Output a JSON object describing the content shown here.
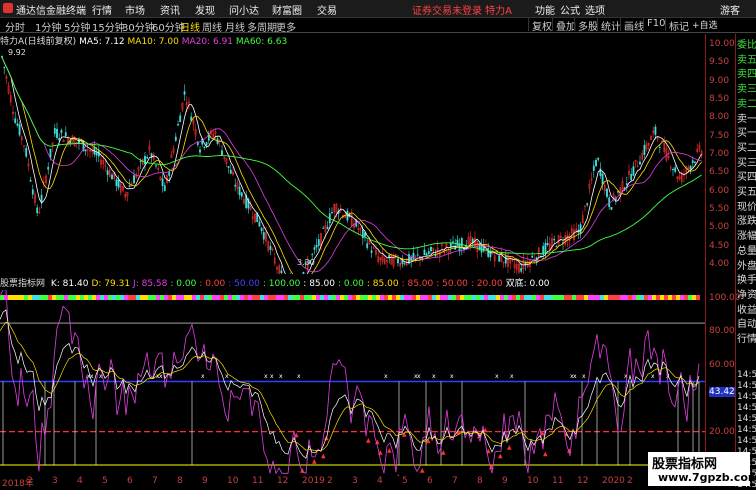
{
  "window": {
    "app_title": "通达信金融终端",
    "menus": [
      "行情",
      "市场",
      "资讯",
      "发现",
      "问小达",
      "财富圈",
      "交易"
    ],
    "warning": "证券交易未登录  特力A",
    "right_menus": [
      "功能",
      "公式",
      "选项"
    ],
    "user": "游客"
  },
  "toolbar": {
    "periods": [
      "分时",
      "1分钟",
      "5分钟",
      "15分钟",
      "30分钟",
      "60分钟",
      "日线",
      "周线",
      "月线",
      "多周期",
      "更多"
    ],
    "active_period": "日线",
    "right_items": [
      "复权",
      "叠加",
      "多股",
      "统计",
      "画线",
      "F10",
      "标记"
    ]
  },
  "main_chart": {
    "stock": "特力A(日线前复权)",
    "ma": [
      {
        "label": "MA5: 7.12",
        "color": "#ffffff"
      },
      {
        "label": "MA10: 7.00",
        "color": "#ffdf00"
      },
      {
        "label": "MA20: 6.91",
        "color": "#e040e0"
      },
      {
        "label": "MA60: 6.63",
        "color": "#40ff40"
      }
    ],
    "high_label": "9.92",
    "low_label": "3.30",
    "y_ticks": [
      "10.00",
      "9.50",
      "9.00",
      "8.50",
      "8.00",
      "7.50",
      "7.00",
      "6.50",
      "6.00",
      "5.50",
      "5.00",
      "4.50",
      "4.00"
    ]
  },
  "sub_chart": {
    "title": "股票指标网",
    "values": [
      {
        "label": "K: 81.40",
        "color": "#ffffff"
      },
      {
        "label": "D: 79.31",
        "color": "#ffdf00"
      },
      {
        "label": "J: 85.58",
        "color": "#e040e0"
      },
      {
        "label": ": 0.00",
        "color": "#40ff40"
      },
      {
        "label": ": 0.00",
        "color": "#ff4040"
      },
      {
        "label": ": 50.00",
        "color": "#4040ff"
      },
      {
        "label": ": 100.00",
        "color": "#40ff40"
      },
      {
        "label": ": 85.00",
        "color": "#ffffff"
      },
      {
        "label": ": 0.00",
        "color": "#40ff40"
      },
      {
        "label": ": 85.00",
        "color": "#ffdf00"
      },
      {
        "label": ": 85.00",
        "color": "#ff4040"
      },
      {
        "label": ": 50.00",
        "color": "#ff4040"
      },
      {
        "label": ": 20.00",
        "color": "#ff4040"
      },
      {
        "label": "双底: 0.00",
        "color": "#ffffff"
      }
    ],
    "y_ticks": [
      "100.00",
      "80.00",
      "60.00",
      "43.42",
      "20.00",
      "0.00"
    ]
  },
  "right_panel": {
    "labels": [
      "委比",
      "卖五",
      "卖四",
      "卖三",
      "卖二",
      "卖一",
      "买一",
      "买二",
      "买三",
      "买四",
      "买五",
      "现价",
      "涨跌",
      "涨幅",
      "总量",
      "外盘",
      "换手",
      "净资",
      "收益",
      "自动",
      "行情"
    ],
    "times": [
      "14:5",
      "14:5",
      "14:5",
      "14:5",
      "14:5",
      "14:5",
      "14:5",
      "14:5",
      "14:5",
      "14:5",
      "14:5"
    ],
    "self_select": "+自选"
  },
  "date_axis": [
    "2018年",
    "2",
    "3",
    "4",
    "5",
    "6",
    "7",
    "8",
    "9",
    "10",
    "11",
    "12",
    "2019",
    "2",
    "3",
    "4",
    "5",
    "6",
    "7",
    "8",
    "9",
    "10",
    "11",
    "12",
    "2020",
    "2",
    "3",
    "4"
  ],
  "watermark": {
    "line1": "股票指标网",
    "line2": "www.7gpzb.com"
  },
  "colors": {
    "up": "#ff3030",
    "down": "#40e0e0",
    "grid": "#8b1a1a"
  }
}
